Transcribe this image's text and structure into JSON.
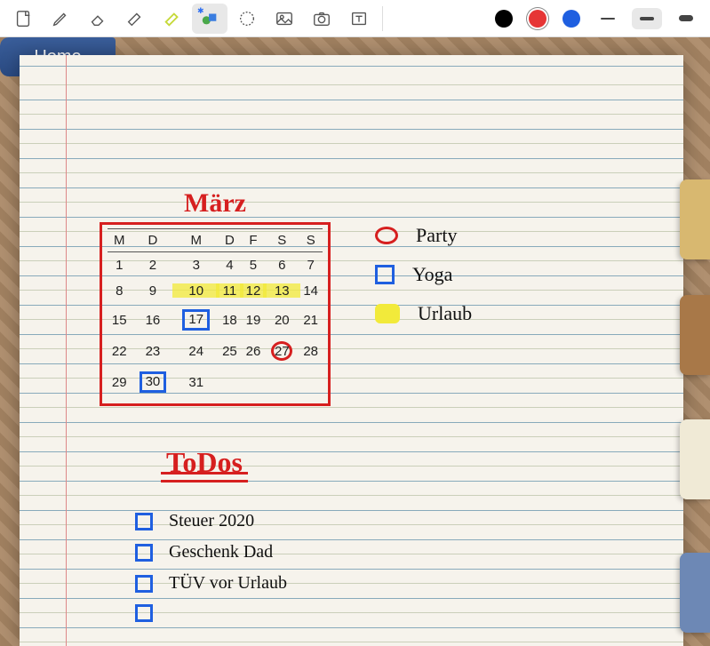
{
  "toolbar": {
    "tools": [
      "page",
      "pencil",
      "eraser",
      "marker",
      "highlighter",
      "shapes",
      "lasso",
      "image",
      "camera",
      "text"
    ],
    "selected_tool": "shapes",
    "colors": [
      "black",
      "red",
      "blue"
    ],
    "selected_color": "red",
    "strokes": [
      "thin",
      "medium",
      "thick"
    ],
    "selected_stroke": "medium"
  },
  "home_tab": {
    "label": "Home"
  },
  "side_tabs": [
    "tab1",
    "tab2",
    "tab3",
    "tab4"
  ],
  "calendar": {
    "month": "März",
    "day_headers": [
      "M",
      "D",
      "M",
      "D",
      "F",
      "S",
      "S"
    ],
    "weeks": [
      [
        1,
        2,
        3,
        4,
        5,
        6,
        7
      ],
      [
        8,
        9,
        10,
        11,
        12,
        13,
        14
      ],
      [
        15,
        16,
        17,
        18,
        19,
        20,
        21
      ],
      [
        22,
        23,
        24,
        25,
        26,
        27,
        28
      ],
      [
        29,
        30,
        31,
        null,
        null,
        null,
        null
      ]
    ],
    "highlight_yellow": [
      10,
      11,
      12,
      13
    ],
    "box_blue": [
      17,
      30
    ],
    "circle_red": [
      27
    ]
  },
  "legend": {
    "items": [
      {
        "marker": "circle-red",
        "label": "Party"
      },
      {
        "marker": "box-blue",
        "label": "Yoga"
      },
      {
        "marker": "blob-yellow",
        "label": "Urlaub"
      }
    ]
  },
  "todos": {
    "title": "ToDos",
    "items": [
      "Steuer 2020",
      "Geschenk Dad",
      "TÜV vor Urlaub",
      ""
    ]
  }
}
